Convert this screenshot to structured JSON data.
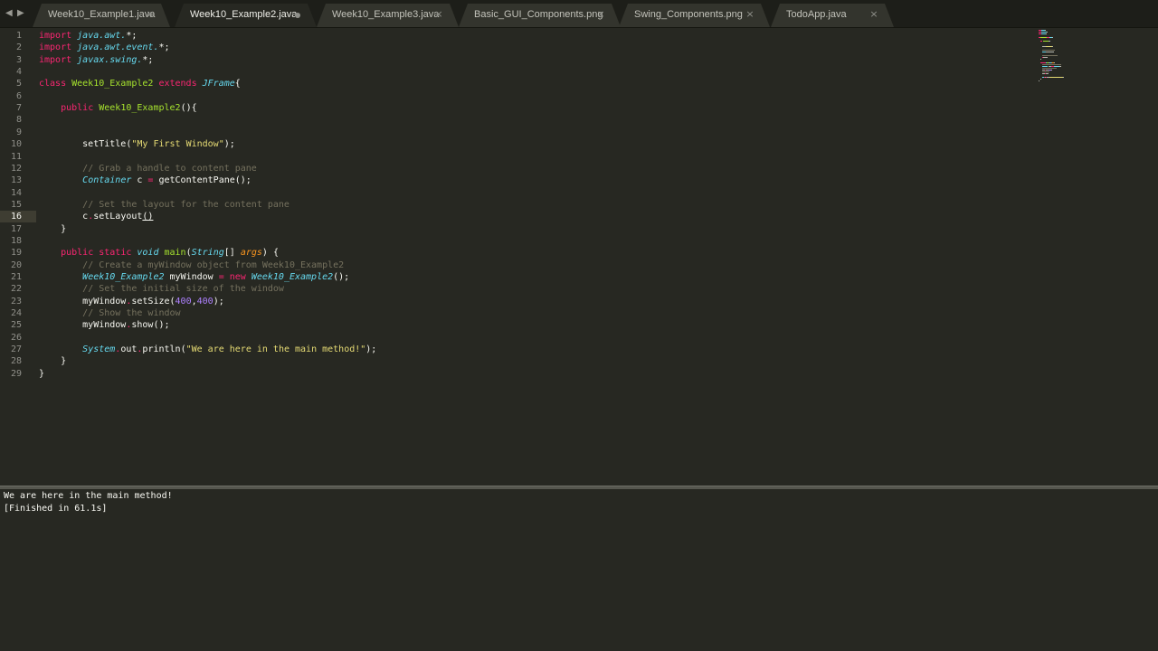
{
  "tabs": [
    {
      "label": "Week10_Example1.java",
      "state": "clean",
      "active": false
    },
    {
      "label": "Week10_Example2.java",
      "state": "dirty",
      "active": true
    },
    {
      "label": "Week10_Example3.java",
      "state": "clean",
      "active": false
    },
    {
      "label": "Basic_GUI_Components.png",
      "state": "clean",
      "active": false
    },
    {
      "label": "Swing_Components.png",
      "state": "clean",
      "active": false
    },
    {
      "label": "TodoApp.java",
      "state": "clean",
      "active": false
    }
  ],
  "icons": {
    "back": "◀",
    "forward": "▶",
    "close": "×"
  },
  "editor": {
    "current_line": 16,
    "lines": [
      [
        [
          "k",
          "import "
        ],
        [
          "t",
          "java.awt."
        ],
        [
          "",
          "*;"
        ]
      ],
      [
        [
          "k",
          "import "
        ],
        [
          "t",
          "java.awt.event."
        ],
        [
          "",
          "*;"
        ]
      ],
      [
        [
          "k",
          "import "
        ],
        [
          "t",
          "javax.swing."
        ],
        [
          "",
          "*;"
        ]
      ],
      [],
      [
        [
          "k",
          "class "
        ],
        [
          "f",
          "Week10_Example2 "
        ],
        [
          "k",
          "extends "
        ],
        [
          "t",
          "JFrame"
        ],
        [
          "",
          "{"
        ]
      ],
      [],
      [
        [
          "",
          "    "
        ],
        [
          "k",
          "public "
        ],
        [
          "f",
          "Week10_Example2"
        ],
        [
          "",
          "(){"
        ]
      ],
      [],
      [],
      [
        [
          "",
          "        setTitle("
        ],
        [
          "s",
          "\"My First Window\""
        ],
        [
          "",
          ");"
        ]
      ],
      [],
      [
        [
          "",
          "        "
        ],
        [
          "c",
          "// Grab a handle to content pane"
        ]
      ],
      [
        [
          "",
          "        "
        ],
        [
          "t",
          "Container"
        ],
        [
          "",
          " c "
        ],
        [
          "k",
          "="
        ],
        [
          "",
          " getContentPane();"
        ]
      ],
      [],
      [
        [
          "",
          "        "
        ],
        [
          "c",
          "// Set the layout for the content pane"
        ]
      ],
      [
        [
          "",
          "        c"
        ],
        [
          "k",
          "."
        ],
        [
          "",
          "setLayout"
        ],
        [
          "ul",
          "()"
        ]
      ],
      [
        [
          "",
          "    }"
        ]
      ],
      [],
      [
        [
          "",
          "    "
        ],
        [
          "k",
          "public static "
        ],
        [
          "t",
          "void "
        ],
        [
          "f",
          "main"
        ],
        [
          "",
          "("
        ],
        [
          "t",
          "String"
        ],
        [
          "",
          "[] "
        ],
        [
          "p",
          "args"
        ],
        [
          "",
          ") {"
        ]
      ],
      [
        [
          "",
          "        "
        ],
        [
          "c",
          "// Create a myWindow object from Week10_Example2"
        ]
      ],
      [
        [
          "",
          "        "
        ],
        [
          "t",
          "Week10_Example2"
        ],
        [
          "",
          " myWindow "
        ],
        [
          "k",
          "= new "
        ],
        [
          "t",
          "Week10_Example2"
        ],
        [
          "",
          "();"
        ]
      ],
      [
        [
          "",
          "        "
        ],
        [
          "c",
          "// Set the initial size of the window"
        ]
      ],
      [
        [
          "",
          "        myWindow"
        ],
        [
          "k",
          "."
        ],
        [
          "",
          "setSize("
        ],
        [
          "n",
          "400"
        ],
        [
          "",
          ","
        ],
        [
          "n",
          "400"
        ],
        [
          "",
          ");"
        ]
      ],
      [
        [
          "",
          "        "
        ],
        [
          "c",
          "// Show the window"
        ]
      ],
      [
        [
          "",
          "        myWindow"
        ],
        [
          "k",
          "."
        ],
        [
          "",
          "show();"
        ]
      ],
      [],
      [
        [
          "",
          "        "
        ],
        [
          "t",
          "System"
        ],
        [
          "k",
          "."
        ],
        [
          "",
          "out"
        ],
        [
          "k",
          "."
        ],
        [
          "",
          "println("
        ],
        [
          "s",
          "\"We are here in the main method!\""
        ],
        [
          "",
          ");"
        ]
      ],
      [
        [
          "",
          "    }"
        ]
      ],
      [
        [
          "",
          "}"
        ]
      ]
    ]
  },
  "output": {
    "lines": [
      "We are here in the main method!",
      "[Finished in 61.1s]"
    ]
  },
  "colors": {
    "background": "#272822",
    "keyword": "#f92672",
    "type": "#66d9ef",
    "function": "#a6e22e",
    "string": "#e6db74",
    "number": "#ae81ff",
    "comment": "#75715e",
    "param": "#fd971f"
  }
}
